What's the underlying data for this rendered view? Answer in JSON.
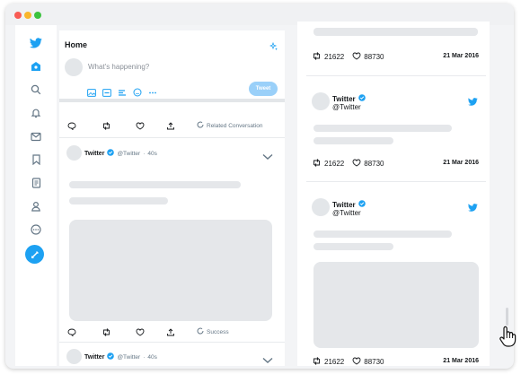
{
  "colors": {
    "accent": "#1da1f2",
    "verified": "#1da1f2"
  },
  "sidebar": {
    "icons": [
      "twitter-bird-icon",
      "home-icon",
      "search-icon",
      "bell-icon",
      "mail-icon",
      "bookmark-icon",
      "list-icon",
      "profile-icon",
      "more-icon",
      "compose-icon"
    ]
  },
  "timeline": {
    "title": "Home",
    "compose_placeholder": "What's happening?",
    "tweet_button": "Tweet",
    "actions_row1": {
      "status": "Related Conversation"
    },
    "tweets": [
      {
        "name": "Twitter",
        "handle": "@Twitter",
        "time": "40s",
        "status": "Success"
      },
      {
        "name": "Twitter",
        "handle": "@Twitter",
        "time": "40s"
      }
    ]
  },
  "right_panel": {
    "top_stats": {
      "retweets": "21622",
      "likes": "88730",
      "date": "21 Mar 2016"
    },
    "cards": [
      {
        "name": "Twitter",
        "handle": "@Twitter",
        "retweets": "21622",
        "likes": "88730",
        "date": "21 Mar 2016"
      },
      {
        "name": "Twitter",
        "handle": "@Twitter",
        "retweets": "21622",
        "likes": "88730",
        "date": "21 Mar 2016"
      }
    ]
  }
}
